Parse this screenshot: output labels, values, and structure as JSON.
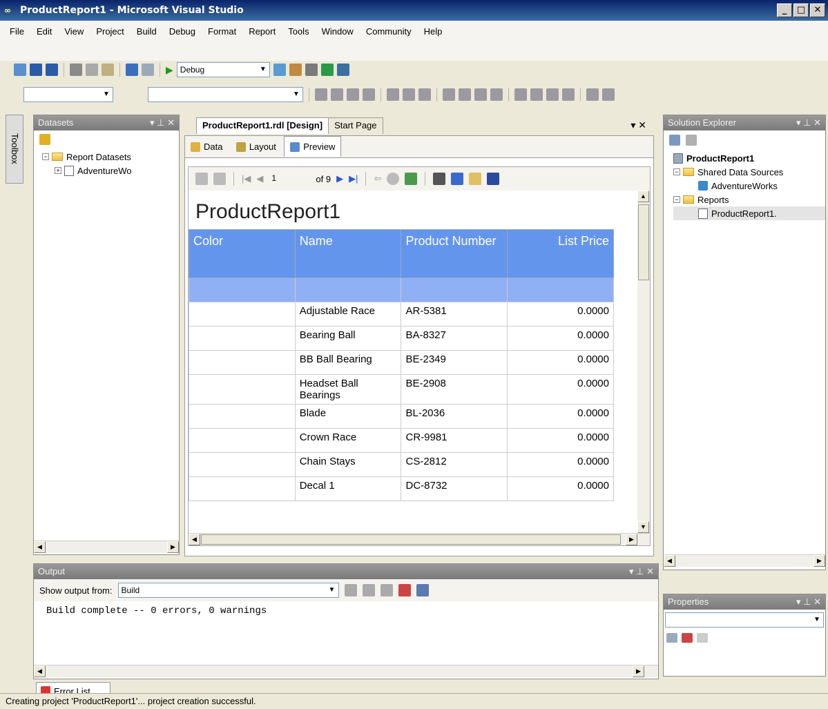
{
  "window": {
    "title": "ProductReport1 - Microsoft Visual Studio",
    "min": "_",
    "max": "□",
    "close": "✕"
  },
  "menu": [
    "File",
    "Edit",
    "View",
    "Project",
    "Build",
    "Debug",
    "Format",
    "Report",
    "Tools",
    "Window",
    "Community",
    "Help"
  ],
  "toolbar": {
    "config": "Debug"
  },
  "toolbox": {
    "label": "Toolbox"
  },
  "datasets": {
    "title": "Datasets",
    "root": "Report Datasets",
    "child": "AdventureWo"
  },
  "doc": {
    "tab_active": "ProductReport1.rdl [Design]",
    "tab2": "Start Page",
    "subtabs": [
      "Data",
      "Layout",
      "Preview"
    ]
  },
  "preview": {
    "page": "1",
    "of": "of 9"
  },
  "report": {
    "title": "ProductReport1",
    "columns": [
      "Color",
      "Name",
      "Product Number",
      "List Price"
    ],
    "rows": [
      [
        "",
        "Adjustable Race",
        "AR-5381",
        "0.0000"
      ],
      [
        "",
        "Bearing Ball",
        "BA-8327",
        "0.0000"
      ],
      [
        "",
        "BB Ball Bearing",
        "BE-2349",
        "0.0000"
      ],
      [
        "",
        "Headset Ball Bearings",
        "BE-2908",
        "0.0000"
      ],
      [
        "",
        "Blade",
        "BL-2036",
        "0.0000"
      ],
      [
        "",
        "Crown Race",
        "CR-9981",
        "0.0000"
      ],
      [
        "",
        "Chain Stays",
        "CS-2812",
        "0.0000"
      ],
      [
        "",
        "Decal 1",
        "DC-8732",
        "0.0000"
      ]
    ]
  },
  "solution": {
    "title": "Solution Explorer",
    "project": "ProductReport1",
    "shared": "Shared Data Sources",
    "ds": "AdventureWorks",
    "reports": "Reports",
    "rpt": "ProductReport1."
  },
  "properties": {
    "title": "Properties"
  },
  "output": {
    "title": "Output",
    "show_label": "Show output from:",
    "source": "Build",
    "text": "Build complete -- 0 errors, 0 warnings"
  },
  "errorlist": {
    "label": "Error List"
  },
  "status": "Creating project 'ProductReport1'... project creation successful."
}
